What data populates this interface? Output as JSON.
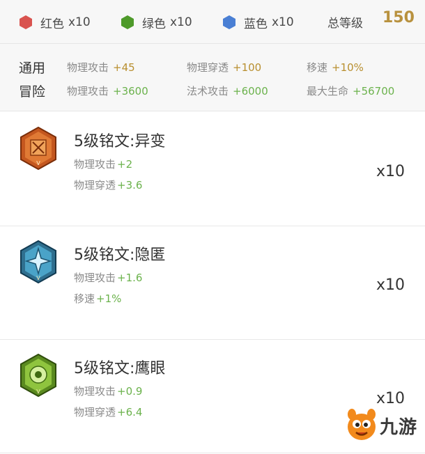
{
  "gems": [
    {
      "label": "红色",
      "count": "x10",
      "color": "#d9534f",
      "icon": "red-gem-icon"
    },
    {
      "label": "绿色",
      "count": "x10",
      "color": "#4e9a2a",
      "icon": "green-gem-icon"
    },
    {
      "label": "蓝色",
      "count": "x10",
      "color": "#4a7fd4",
      "icon": "blue-gem-icon"
    }
  ],
  "total": {
    "label": "总等级",
    "value": "150"
  },
  "general": {
    "title": "通用",
    "stats": [
      {
        "name": "物理攻击",
        "value": "+45"
      },
      {
        "name": "物理穿透",
        "value": "+100"
      },
      {
        "name": "移速",
        "value": "+10%"
      }
    ]
  },
  "adventure": {
    "title": "冒险",
    "stats": [
      {
        "name": "物理攻击",
        "value": "+3600"
      },
      {
        "name": "法术攻击",
        "value": "+6000"
      },
      {
        "name": "最大生命",
        "value": "+56700"
      }
    ]
  },
  "inscriptions": [
    {
      "title": "5级铭文:异变",
      "badge": "orange-inscription-badge-icon",
      "stats": [
        {
          "name": "物理攻击",
          "value": "+2"
        },
        {
          "name": "物理穿透",
          "value": "+3.6"
        }
      ],
      "count": "x10"
    },
    {
      "title": "5级铭文:隐匿",
      "badge": "blue-inscription-badge-icon",
      "stats": [
        {
          "name": "物理攻击",
          "value": "+1.6"
        },
        {
          "name": "移速",
          "value": "+1%"
        }
      ],
      "count": "x10"
    },
    {
      "title": "5级铭文:鹰眼",
      "badge": "green-inscription-badge-icon",
      "stats": [
        {
          "name": "物理攻击",
          "value": "+0.9"
        },
        {
          "name": "物理穿透",
          "value": "+6.4"
        }
      ],
      "count": "x10"
    }
  ],
  "watermark": {
    "text": "九游"
  },
  "colors": {
    "gold": "#b88f2f",
    "green": "#6bb24c"
  }
}
